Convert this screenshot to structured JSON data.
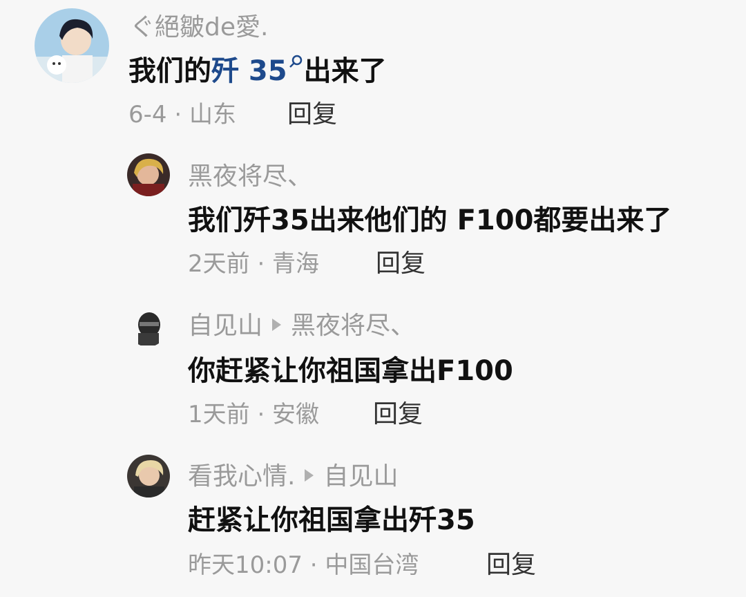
{
  "comments": [
    {
      "user": "ぐ絕皺de愛.",
      "text_prefix": "我们的",
      "text_link": "歼 35",
      "text_suffix": "出来了",
      "time_location": "6-4 · 山东",
      "reply_label": "回复"
    },
    {
      "user": "黑夜将尽、",
      "text": "我们歼35出来他们的 F100都要出来了",
      "time_location": "2天前 · 青海",
      "reply_label": "回复"
    },
    {
      "user": "自见山",
      "reply_to": "黑夜将尽、",
      "text": "你赶紧让你祖国拿出F100",
      "time_location": "1天前 · 安徽",
      "reply_label": "回复"
    },
    {
      "user": "看我心情.",
      "reply_to": "自见山",
      "text": "赶紧让你祖国拿出歼35",
      "time_location": "昨天10:07 · 中国台湾",
      "reply_label": "回复"
    }
  ],
  "icons": {
    "search_in_text": "search-icon",
    "reply_to_arrow": "play-arrow-icon"
  },
  "colors": {
    "background": "#f7f7f7",
    "username": "#9a9a9a",
    "body_text": "#111111",
    "link": "#1e4a8c",
    "meta": "#9a9a9a"
  }
}
